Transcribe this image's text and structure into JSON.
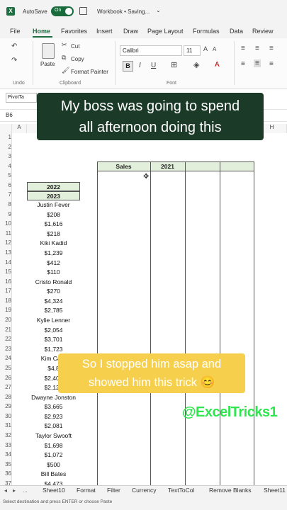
{
  "title_bar": {
    "app_icon": "excel-icon",
    "autosave_label": "AutoSave",
    "toggle_state": "On",
    "workbook_title": "Workbook • Saving...",
    "chevron": "⌄"
  },
  "ribbon_tabs": [
    "File",
    "Home",
    "Favorites",
    "Insert",
    "Draw",
    "Page Layout",
    "Formulas",
    "Data",
    "Review"
  ],
  "active_tab": "Home",
  "clipboard": {
    "paste": "Paste",
    "cut": "Cut",
    "copy": "Copy",
    "format_painter": "Format Painter",
    "group_label": "Clipboard"
  },
  "undo_group": "Undo",
  "font": {
    "name": "Calibri",
    "size": "11",
    "bold": "B",
    "italic": "I",
    "underline": "U",
    "group_label": "Font"
  },
  "quick_access": {
    "pivot": "PivotTa"
  },
  "name_box": "B6",
  "columns": [
    "A",
    "B",
    "H"
  ],
  "captions": {
    "top": [
      "My boss was going to spend",
      "all afternoon doing this"
    ],
    "middle": [
      "So I stopped him asap and",
      "showed him this trick 😊"
    ],
    "handle": "@ExcelTricks1"
  },
  "column_b": [
    {
      "row": "1",
      "text": "",
      "header": false
    },
    {
      "row": "2",
      "text": "",
      "header": false
    },
    {
      "row": "3",
      "text": "",
      "header": false
    },
    {
      "row": "4",
      "text": "",
      "header": false
    },
    {
      "row": "5",
      "text": "",
      "header": false
    },
    {
      "row": "6",
      "text": "2022",
      "header": true
    },
    {
      "row": "7",
      "text": "2023",
      "header": true
    },
    {
      "row": "8",
      "text": "Justin Fever",
      "header": false
    },
    {
      "row": "9",
      "text": "$208",
      "header": false
    },
    {
      "row": "10",
      "text": "$1,616",
      "header": false
    },
    {
      "row": "11",
      "text": "$218",
      "header": false
    },
    {
      "row": "12",
      "text": "Kiki Kadid",
      "header": false
    },
    {
      "row": "13",
      "text": "$1,239",
      "header": false
    },
    {
      "row": "14",
      "text": "$412",
      "header": false
    },
    {
      "row": "15",
      "text": "$110",
      "header": false
    },
    {
      "row": "16",
      "text": "Cristo Ronald",
      "header": false
    },
    {
      "row": "17",
      "text": "$270",
      "header": false
    },
    {
      "row": "18",
      "text": "$4,324",
      "header": false
    },
    {
      "row": "19",
      "text": "$2,785",
      "header": false
    },
    {
      "row": "20",
      "text": "Kylie Lenner",
      "header": false
    },
    {
      "row": "21",
      "text": "$2,054",
      "header": false
    },
    {
      "row": "22",
      "text": "$3,701",
      "header": false
    },
    {
      "row": "23",
      "text": "$1,723",
      "header": false
    },
    {
      "row": "24",
      "text": "Kim Card",
      "header": false
    },
    {
      "row": "25",
      "text": "$4,8",
      "header": false
    },
    {
      "row": "26",
      "text": "$2,400",
      "header": false
    },
    {
      "row": "27",
      "text": "$2,120",
      "header": false
    },
    {
      "row": "28",
      "text": "Dwayne Jonston",
      "header": false
    },
    {
      "row": "29",
      "text": "$3,665",
      "header": false
    },
    {
      "row": "30",
      "text": "$2,923",
      "header": false
    },
    {
      "row": "31",
      "text": "$2,081",
      "header": false
    },
    {
      "row": "32",
      "text": "Taylor Swooft",
      "header": false
    },
    {
      "row": "33",
      "text": "$1,698",
      "header": false
    },
    {
      "row": "34",
      "text": "$1,072",
      "header": false
    },
    {
      "row": "35",
      "text": "$500",
      "header": false
    },
    {
      "row": "36",
      "text": "Bill Bates",
      "header": false
    },
    {
      "row": "37",
      "text": "$4,473",
      "header": false
    }
  ],
  "target_table": {
    "headers": [
      "Sales",
      "2021",
      "",
      ""
    ]
  },
  "sheet_tabs": [
    "Sheet10",
    "Format",
    "Filter",
    "Currency",
    "TextToCol",
    "Remove Blanks",
    "Sheet11"
  ],
  "sheet_nav": [
    "◂",
    "▸",
    "..."
  ],
  "status_text": "Select destination and press ENTER or choose Paste",
  "colors": {
    "excel_green": "#1d6f42",
    "header_fill": "#e2efda",
    "caption_dark": "#1c3a28",
    "caption_yellow": "#f6cf4d",
    "handle_green": "#2ee64e"
  }
}
